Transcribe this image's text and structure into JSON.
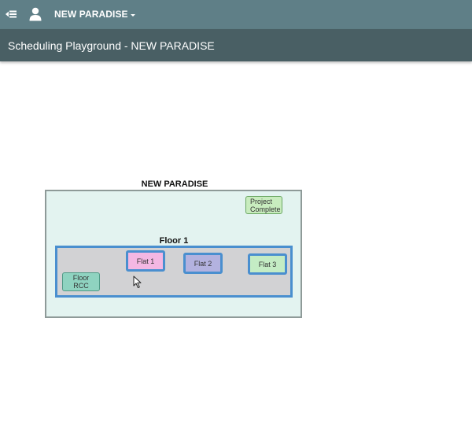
{
  "topbar": {
    "back_icon": "menu-collapse-icon",
    "user_icon": "user-icon",
    "project_name": "NEW PARADISE",
    "background": "#5f7f87"
  },
  "titlebar": {
    "title": "Scheduling Playground - NEW PARADISE",
    "background": "#495f64"
  },
  "diagram": {
    "project_label": "NEW PARADISE",
    "project_complete": "Project Complete",
    "floor_label": "Floor 1",
    "floor_rcc": "Floor RCC",
    "flats": [
      "Flat 1",
      "Flat 2",
      "Flat 3"
    ],
    "colors": {
      "project_bg": "#e3f3f0",
      "floor_bg": "#d2d2d4",
      "selection_border": "#4a8fcf",
      "flat1": "#f4b7e3",
      "flat2": "#b3b2df",
      "flat3": "#c4ecc4",
      "floor_rcc": "#8fd3c0",
      "project_complete": "#c8ecbe"
    }
  }
}
